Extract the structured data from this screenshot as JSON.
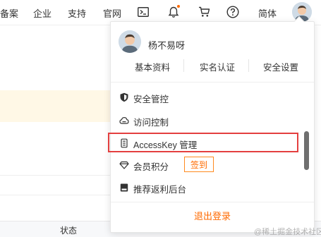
{
  "topnav": {
    "items": [
      "备案",
      "企业",
      "支持",
      "官网"
    ],
    "icons": [
      "terminal-icon",
      "bell-icon",
      "cart-icon",
      "help-icon"
    ],
    "language": "简体",
    "accent_color": "#ff6a00"
  },
  "background": {
    "footer_label": "状态",
    "watermark": "@稀土掘金技术社区"
  },
  "dropdown": {
    "user_name": "杨不易呀",
    "quick_links": [
      "基本资料",
      "实名认证",
      "安全设置"
    ],
    "menu_items": [
      {
        "label": "安全管控",
        "icon": "shield-icon"
      },
      {
        "label": "访问控制",
        "icon": "cloud-icon"
      },
      {
        "label": "AccessKey 管理",
        "icon": "key-icon",
        "highlighted": true
      },
      {
        "label": "会员积分",
        "icon": "diamond-icon",
        "action": "签到"
      },
      {
        "label": "推荐返利后台",
        "icon": "wallet-icon"
      }
    ],
    "logout": "退出登录",
    "highlight_color": "#e43f3f"
  }
}
